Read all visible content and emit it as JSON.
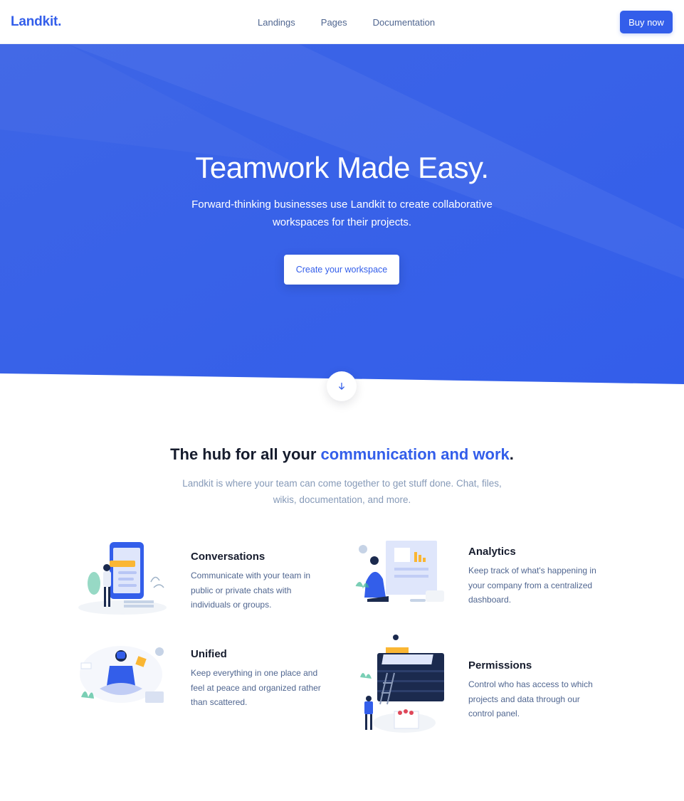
{
  "navbar": {
    "brand": "Landkit.",
    "links": [
      "Landings",
      "Pages",
      "Documentation"
    ],
    "buy_label": "Buy now"
  },
  "hero": {
    "title": "Teamwork Made Easy.",
    "subtitle_lines": [
      "Forward-thinking businesses use Landkit to create collaborative",
      "workspaces for their projects."
    ],
    "cta_label": "Create your workspace"
  },
  "section": {
    "title_main": "The hub for all your ",
    "title_accent": "communication and work",
    "title_end": ".",
    "subtitle_lines": [
      "Landkit is where your team can come together to get stuff done. Chat, files,",
      "wikis, documentation, and more."
    ]
  },
  "features": [
    {
      "title": "Conversations",
      "lines": [
        "Communicate with your team in",
        "public or private chats with",
        "individuals or groups."
      ]
    },
    {
      "title": "Analytics",
      "lines": [
        "Keep track of what's happening in",
        "your company from a centralized",
        "dashboard."
      ]
    },
    {
      "title": "Unified",
      "lines": [
        "Keep everything in one place and",
        "feel at peace and organized rather",
        "than scattered."
      ]
    },
    {
      "title": "Permissions",
      "lines": [
        "Control who has access to which",
        "projects and data through our",
        "control panel."
      ]
    }
  ],
  "colors": {
    "primary": "#335eea",
    "dark": "#161c2d",
    "muted": "#869ab8",
    "body": "#506690"
  },
  "icons": {
    "scroll": "arrow-down-icon"
  }
}
